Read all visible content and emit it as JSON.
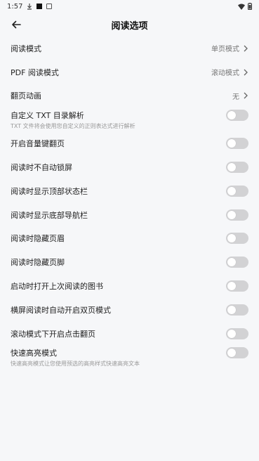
{
  "status_bar": {
    "time": "1:57"
  },
  "header": {
    "title": "阅读选项"
  },
  "nav_rows": [
    {
      "label": "阅读模式",
      "value": "单页模式"
    },
    {
      "label": "PDF 阅读模式",
      "value": "滚动模式"
    },
    {
      "label": "翻页动画",
      "value": "无"
    }
  ],
  "toggle_rows": [
    {
      "label": "自定义 TXT 目录解析",
      "desc": "TXT 文件将会使用您自定义的正则表达式进行解析",
      "on": false
    },
    {
      "label": "开启音量键翻页",
      "on": false
    },
    {
      "label": "阅读时不自动锁屏",
      "on": false
    },
    {
      "label": "阅读时显示顶部状态栏",
      "on": false
    },
    {
      "label": "阅读时显示底部导航栏",
      "on": false
    },
    {
      "label": "阅读时隐藏页眉",
      "on": false
    },
    {
      "label": "阅读时隐藏页脚",
      "on": false
    },
    {
      "label": "启动时打开上次阅读的图书",
      "on": false
    },
    {
      "label": "横屏阅读时自动开启双页模式",
      "on": false
    },
    {
      "label": "滚动模式下开启点击翻页",
      "on": false
    },
    {
      "label": "快速高亮模式",
      "desc": "快速高亮模式让您使用预选的高亮样式快速高亮文本",
      "on": false
    }
  ],
  "colors": {
    "background": "#f6f7f9",
    "toggle_off": "#d2d2d4"
  }
}
